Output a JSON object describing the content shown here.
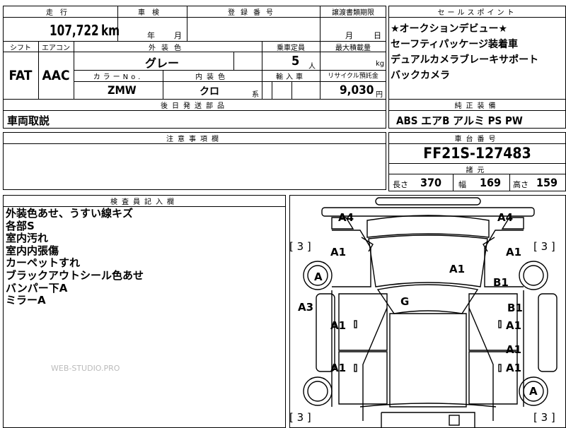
{
  "top": {
    "mileage_label": "走行",
    "mileage_value": "107,722",
    "mileage_unit": "km",
    "inspection_label": "車検",
    "inspection_year": "年",
    "inspection_month": "月",
    "registration_label": "登録番号",
    "transfer_label": "譲渡書類期限",
    "transfer_month": "月",
    "transfer_day": "日"
  },
  "specs": {
    "shift_label": "シフト",
    "shift_value": "FAT",
    "ac_label": "エアコン",
    "ac_value": "AAC",
    "exterior_color_label": "外装色",
    "exterior_color_value": "グレー",
    "capacity_label": "乗車定員",
    "capacity_value": "5",
    "capacity_unit": "人",
    "max_load_label": "最大積載量",
    "max_load_unit": "kg",
    "color_no_label": "カラーNo.",
    "color_no_value": "ZMW",
    "interior_color_label": "内装色",
    "interior_color_value": "クロ",
    "interior_color_suffix": "系",
    "import_label": "輸入車",
    "recycle_label": "リサイクル預託金",
    "recycle_value": "9,030",
    "recycle_unit": "円",
    "later_parts_label": "後日発送部品",
    "later_parts_value": "車両取説"
  },
  "sales_points": {
    "header": "セールスポイント",
    "lines": [
      "★オークションデビュー★",
      "セーフティパッケージ装着車",
      "デュアルカメラブレーキサポート",
      "バックカメラ"
    ]
  },
  "equipment": {
    "header": "純正装備",
    "value": "ABS エアB アルミ PS PW"
  },
  "notes": {
    "header": "注意事項欄"
  },
  "chassis": {
    "header": "車台番号",
    "value": "FF21S-127483",
    "dims_header": "諸元",
    "length_label": "長さ",
    "length_value": "370",
    "width_label": "幅",
    "width_value": "169",
    "height_label": "高さ",
    "height_value": "159"
  },
  "inspector": {
    "header": "検査員記入欄",
    "lines": [
      "外装色あせ、うすい線キズ",
      "各部S",
      "室内汚れ",
      "室内内張傷",
      "カーペットすれ",
      "ブラックアウトシール色あせ",
      "バンパー下A",
      "ミラーA"
    ],
    "watermark": "WEB-STUDIO.PRO"
  },
  "diagram": {
    "labels": {
      "front_left_corner": "A4",
      "front_right_corner": "A4",
      "tire_front_left": "[ 3 ]",
      "tire_front_right": "[ 3 ]",
      "tire_rear_left": "[ 3 ]",
      "tire_rear_right": "[ 3 ]",
      "front_left_fender": "A1",
      "front_right_fender": "A1",
      "hood": "A1",
      "front_left_wheel": "A",
      "right_front_b1": "B1",
      "windshield": "G",
      "left_side": "A3",
      "right_side_b1": "B1",
      "left_front_door": "A1",
      "right_front_door": "A1",
      "right_rear_a1": "A1",
      "left_rear_door": "A1",
      "right_rear_door": "A1",
      "rear_right_wheel": "A"
    }
  }
}
